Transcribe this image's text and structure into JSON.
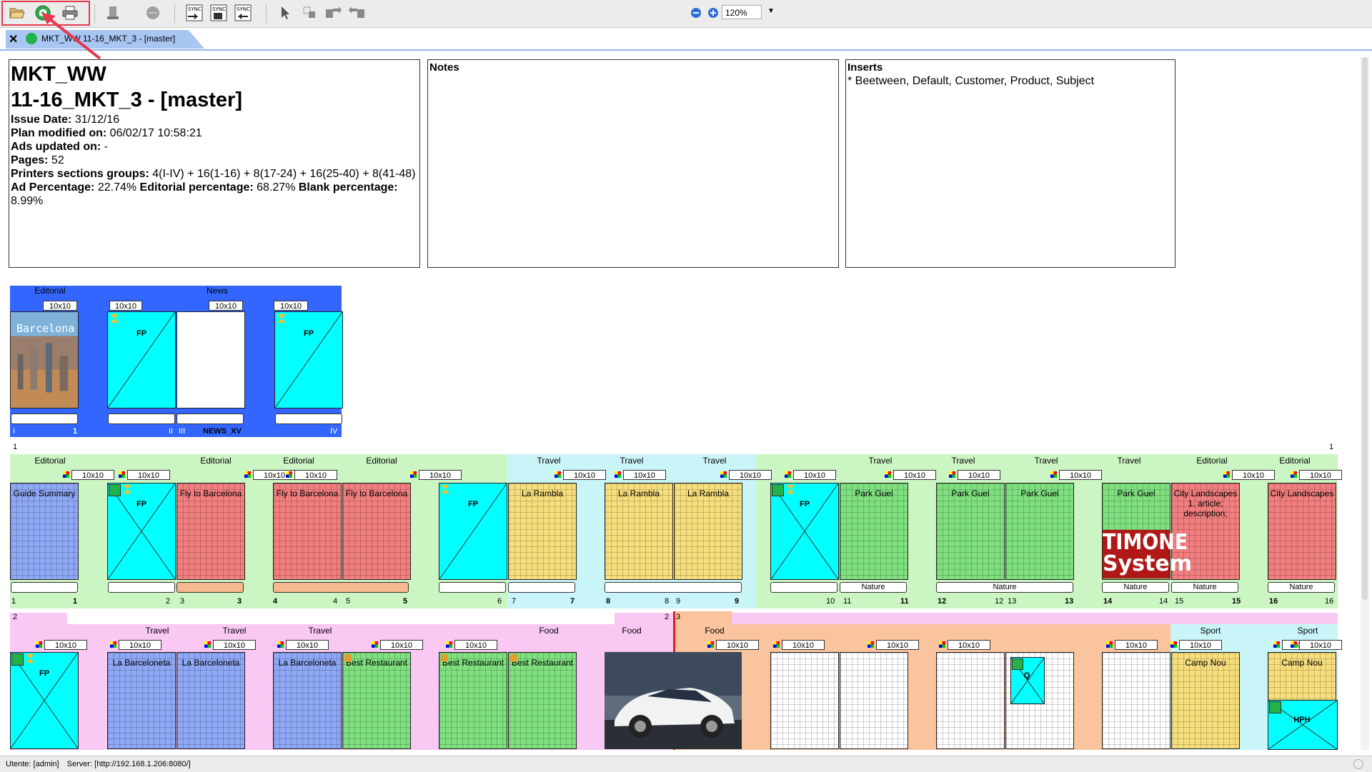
{
  "toolbar": {
    "zoom_value": "120%",
    "sync_labels": [
      "SYNC",
      "SYNC",
      "SYNC"
    ]
  },
  "tab": {
    "title": "MKT_WW 11-16_MKT_3 - [master]",
    "status_color": "#21b24a"
  },
  "info": {
    "title_line1": "MKT_WW",
    "title_line2": "11-16_MKT_3 - [master]",
    "issue_date_label": "Issue Date:",
    "issue_date": "31/12/16",
    "plan_modified_label": "Plan modified on:",
    "plan_modified": "06/02/17 10:58:21",
    "ads_updated_label": "Ads updated on:",
    "ads_updated": "-",
    "pages_label": "Pages:",
    "pages": "52",
    "printers_label": "Printers sections groups:",
    "printers": "4(I-IV) + 16(1-16) + 8(17-24) + 16(25-40) + 8(41-48)",
    "ad_pct_label": "Ad Percentage:",
    "ad_pct": "22.74%",
    "ed_pct_label": "Editorial percentage:",
    "ed_pct": "68.27%",
    "blank_pct_label": "Blank percentage:",
    "blank_pct": "8.99%"
  },
  "notes": {
    "label": "Notes"
  },
  "inserts": {
    "label": "Inserts",
    "text": "* Beetween, Default, Customer, Product, Subject"
  },
  "plan": {
    "row0": {
      "sections": [
        "Editorial",
        "News"
      ],
      "tags": [
        "10x10",
        "10x10",
        "10x10",
        "10x10"
      ],
      "cover_text": "Barcelona",
      "fp_label": "FP",
      "numbers": [
        "I",
        "1",
        "II",
        "III",
        "NEWS_XV",
        "IV"
      ]
    },
    "row1": {
      "group_number": "1",
      "group_number_right": "1",
      "sections": [
        "Editorial",
        "Editorial",
        "Editorial",
        "Editorial",
        "Travel",
        "Travel",
        "Travel",
        "Travel",
        "Travel",
        "Travel",
        "Travel",
        "Editorial",
        "Editorial"
      ],
      "tag": "10x10",
      "pages": [
        "Guide Summary",
        "FP",
        "Fly to Barcelona",
        "Fly to Barcelona",
        "Fly to Barcelona",
        "FP",
        "La Rambla",
        "La Rambla",
        "La Rambla",
        "FP",
        "Park Guel",
        "Park Guel",
        "Park Guel",
        "Park Guel",
        "City Landscapes 1. article; description;",
        "City Landscapes"
      ],
      "slot_labels": [
        "Nature",
        "Nature",
        "Nature",
        "Nature",
        "Nature"
      ],
      "logo_line1": "TIMONE",
      "logo_line2": "System",
      "numbers": [
        "1",
        "1",
        "2",
        "3",
        "3",
        "4",
        "4",
        "5",
        "5",
        "6",
        "7",
        "7",
        "8",
        "8",
        "9",
        "9",
        "10",
        "11",
        "11",
        "12",
        "12",
        "13",
        "13",
        "14",
        "14",
        "15",
        "15",
        "16",
        "16"
      ]
    },
    "row2": {
      "group_number": "2",
      "group_number_b": "2",
      "group_number_c": "3",
      "sections": [
        "Travel",
        "Travel",
        "Travel",
        "Food",
        "Food",
        "Food",
        "Sport",
        "Sport"
      ],
      "tag": "10x10",
      "pages": [
        "FP",
        "La Barceloneta",
        "La Barceloneta",
        "La Barceloneta",
        "Best Restaurant",
        "Best Restaurant",
        "Best Restaurant",
        "Camp Nou",
        "Camp Nou"
      ],
      "q_label": "Q",
      "hph_label": "HPH"
    }
  },
  "status": {
    "user": "Utente: [admin]",
    "server": "Server: [http://192.168.1.206:8080/]"
  },
  "colors": {
    "accent_blue": "#3366ff",
    "editorial_green": "#ccf5c4",
    "travel_cyan": "#c9f5f8",
    "food_pink": "#f9c8f3",
    "orange_band": "#f9c49e",
    "page_blue": "#8fa8f5",
    "page_red": "#f27f7f",
    "page_yellow": "#f7de7c",
    "page_green": "#7fe07f",
    "fp_cyan": "#00ffff",
    "highlight": "#e53950"
  }
}
